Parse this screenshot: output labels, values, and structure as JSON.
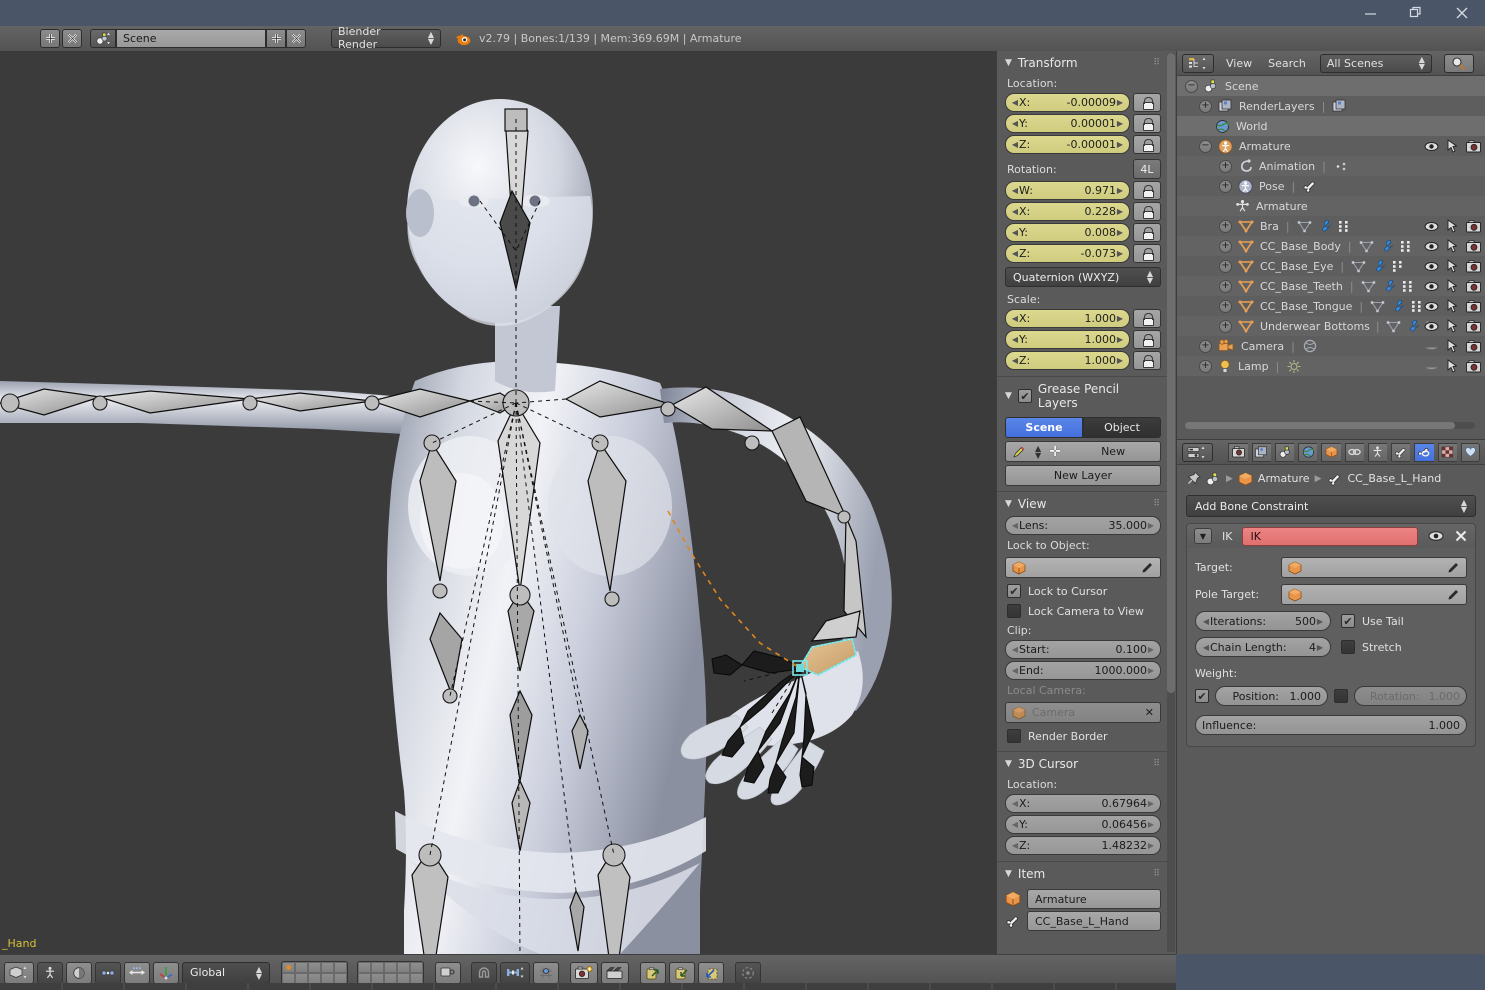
{
  "window": {
    "minimize": "—",
    "restore": "❐",
    "close": "✕"
  },
  "topbar": {
    "screen_add": "+",
    "screen_remove": "✕",
    "scene_name": "Scene",
    "scene_add": "+",
    "scene_remove": "✕",
    "render_engine": "Blender Render",
    "status": "v2.79 | Bones:1/139  | Mem:369.69M | Armature",
    "blender_icon": "blender-logo-icon"
  },
  "viewport": {
    "active_bone_label": "_Hand",
    "background": "#3b3b3b"
  },
  "npanel": {
    "transform": {
      "title": "Transform",
      "location_label": "Location:",
      "location": [
        {
          "axis": "X:",
          "value": "-0.00009"
        },
        {
          "axis": "Y:",
          "value": "0.00001"
        },
        {
          "axis": "Z:",
          "value": "-0.00001"
        }
      ],
      "rotation_label": "Rotation:",
      "rotation_mode_btn": "4L",
      "rotation": [
        {
          "axis": "W:",
          "value": "0.971"
        },
        {
          "axis": "X:",
          "value": "0.228"
        },
        {
          "axis": "Y:",
          "value": "0.008"
        },
        {
          "axis": "Z:",
          "value": "-0.073"
        }
      ],
      "rotation_mode": "Quaternion (WXYZ)",
      "scale_label": "Scale:",
      "scale": [
        {
          "axis": "X:",
          "value": "1.000"
        },
        {
          "axis": "Y:",
          "value": "1.000"
        },
        {
          "axis": "Z:",
          "value": "1.000"
        }
      ]
    },
    "grease_pencil": {
      "title": "Grease Pencil Layers",
      "scene_tab": "Scene",
      "object_tab": "Object",
      "new_btn": "New",
      "new_layer_btn": "New Layer"
    },
    "view": {
      "title": "View",
      "lens_label": "Lens:",
      "lens_value": "35.000",
      "lock_object_label": "Lock to Object:",
      "lock_object_value": "",
      "lock_cursor": "Lock to Cursor",
      "lock_camera": "Lock Camera to View",
      "clip_label": "Clip:",
      "clip_start_label": "Start:",
      "clip_start_value": "0.100",
      "clip_end_label": "End:",
      "clip_end_value": "1000.000",
      "local_camera_label": "Local Camera:",
      "local_camera_value": "Camera",
      "render_border": "Render Border"
    },
    "cursor": {
      "title": "3D Cursor",
      "location_label": "Location:",
      "location": [
        {
          "axis": "X:",
          "value": "0.67964"
        },
        {
          "axis": "Y:",
          "value": "0.06456"
        },
        {
          "axis": "Z:",
          "value": "1.48232"
        }
      ]
    },
    "item": {
      "title": "Item",
      "object_name": "Armature",
      "bone_name": "CC_Base_L_Hand"
    }
  },
  "outliner": {
    "header": {
      "view_menu": "View",
      "search_menu": "Search",
      "display_mode": "All Scenes",
      "search_icon": "magnifier-icon",
      "editor_icon": "outliner-editor-icon"
    },
    "rows": [
      {
        "label": "Scene",
        "indent": 0,
        "expander": "−",
        "icon": "scene-icon",
        "selected": true,
        "cols": []
      },
      {
        "label": "RenderLayers",
        "indent": 22,
        "expander": "+",
        "icon": "renderlayer-icon",
        "selected": false,
        "extra": "renderlayer-copy-icon",
        "cols": []
      },
      {
        "label": "World",
        "indent": 38,
        "expander": "",
        "icon": "world-icon",
        "selected": true,
        "cols": []
      },
      {
        "label": "Armature",
        "indent": 22,
        "expander": "−",
        "icon": "armature-icon",
        "selected": false,
        "cols": [
          "eye",
          "cursor",
          "camera"
        ]
      },
      {
        "label": "Animation",
        "indent": 42,
        "expander": "+",
        "icon": "animation-icon",
        "selected": false,
        "extra": "action-icon",
        "cols": []
      },
      {
        "label": "Pose",
        "indent": 42,
        "expander": "+",
        "icon": "pose-icon",
        "selected": false,
        "extra": "bone-icon",
        "cols": []
      },
      {
        "label": "Armature",
        "indent": 58,
        "expander": "",
        "icon": "armature-data-icon",
        "selected": false,
        "cols": []
      },
      {
        "label": "Bra",
        "indent": 42,
        "expander": "+",
        "icon": "mesh-icon",
        "selected": false,
        "extra": "mesh-data-wrench-verts",
        "cols": [
          "eye",
          "cursor",
          "camera"
        ]
      },
      {
        "label": "CC_Base_Body",
        "indent": 42,
        "expander": "+",
        "icon": "mesh-icon",
        "selected": false,
        "extra": "mesh-data-wrench-verts",
        "cols": [
          "eye",
          "cursor",
          "camera"
        ]
      },
      {
        "label": "CC_Base_Eye",
        "indent": 42,
        "expander": "+",
        "icon": "mesh-icon",
        "selected": false,
        "extra": "mesh-data-wrench-verts",
        "cols": [
          "eye",
          "cursor",
          "camera"
        ]
      },
      {
        "label": "CC_Base_Teeth",
        "indent": 42,
        "expander": "+",
        "icon": "mesh-icon",
        "selected": false,
        "extra": "mesh-data-wrench-verts",
        "cols": [
          "eye",
          "cursor",
          "camera"
        ]
      },
      {
        "label": "CC_Base_Tongue",
        "indent": 42,
        "expander": "+",
        "icon": "mesh-icon",
        "selected": false,
        "extra": "mesh-data-wrench-verts",
        "cols": [
          "eye",
          "cursor",
          "camera"
        ]
      },
      {
        "label": "Underwear Bottoms",
        "indent": 42,
        "expander": "+",
        "icon": "mesh-icon",
        "selected": false,
        "extra": "mesh-data-wrench-verts",
        "cols": [
          "eye",
          "cursor",
          "camera"
        ]
      },
      {
        "label": "Camera",
        "indent": 22,
        "expander": "+",
        "icon": "camera-obj-icon",
        "selected": false,
        "extra": "camera-data-icon",
        "cols": [
          "eye-off",
          "cursor",
          "camera"
        ]
      },
      {
        "label": "Lamp",
        "indent": 22,
        "expander": "+",
        "icon": "lamp-obj-icon",
        "selected": false,
        "extra": "lamp-data-icon",
        "cols": [
          "eye-off",
          "cursor",
          "camera"
        ]
      }
    ]
  },
  "properties": {
    "tabs": [
      {
        "name": "render-tab",
        "icon": "camera-back-icon",
        "active": false
      },
      {
        "name": "render-layers-tab",
        "icon": "images-icon",
        "active": false
      },
      {
        "name": "scene-tab",
        "icon": "scene-icon",
        "active": false
      },
      {
        "name": "world-tab",
        "icon": "world-icon",
        "active": false
      },
      {
        "name": "object-tab",
        "icon": "cube-icon",
        "active": false
      },
      {
        "name": "object-constraints-tab",
        "icon": "chain-icon",
        "active": false
      },
      {
        "name": "object-data-tab",
        "icon": "armature-icon",
        "active": false
      },
      {
        "name": "bone-tab",
        "icon": "bone-icon",
        "active": false
      },
      {
        "name": "bone-constraint-tab",
        "icon": "bone-chain-icon",
        "active": true
      },
      {
        "name": "texture-tab",
        "icon": "checker-icon",
        "active": false
      },
      {
        "name": "physics-tab",
        "icon": "physics-icon",
        "active": false
      }
    ],
    "breadcrumb": {
      "pin_icon": "pin-icon",
      "scene_icon": "scene-icon",
      "object": "Armature",
      "bone": "CC_Base_L_Hand"
    },
    "add_constraint": "Add Bone Constraint",
    "constraint": {
      "type_label": "IK",
      "name": "IK",
      "name_color": "#e07070",
      "eye_icon": "eye-icon",
      "close_icon": "close-x-icon",
      "target_label": "Target:",
      "target_value": "",
      "pole_target_label": "Pole Target:",
      "pole_target_value": "",
      "iterations_label": "Iterations:",
      "iterations_value": "500",
      "chain_length_label": "Chain Length:",
      "chain_length_value": "4",
      "use_tail_label": "Use Tail",
      "use_tail_checked": true,
      "stretch_label": "Stretch",
      "stretch_checked": false,
      "weight_label": "Weight:",
      "position_label": "Position:",
      "position_value": "1.000",
      "position_checked": true,
      "rotation_label": "Rotation:",
      "rotation_value": "1.000",
      "rotation_checked": false,
      "influence_label": "Influence:",
      "influence_value": "1.000"
    }
  },
  "bottombar": {
    "editor_icon": "3dview-editor-icon",
    "mode_icon": "pose-mode-icon",
    "viewport_shading_icon": "solid-shading-icon",
    "pivot_icon": "pivot-median-icon",
    "manipulator_icon": "manipulator-translate-icon",
    "orientation": "Global",
    "snap_icon": "magnet-icon",
    "snap_target_icon": "snap-closest-icon",
    "snap_element_icon": "snap-increment-icon",
    "render_icon": "render-image-icon",
    "animation_icon": "render-animation-icon",
    "pose_copy_icon": "pose-copy-icon",
    "pose_paste_icon": "pose-paste-icon",
    "pose_paste_flip_icon": "pose-paste-flipped-icon",
    "proportional_icon": "proportional-edit-icon"
  }
}
